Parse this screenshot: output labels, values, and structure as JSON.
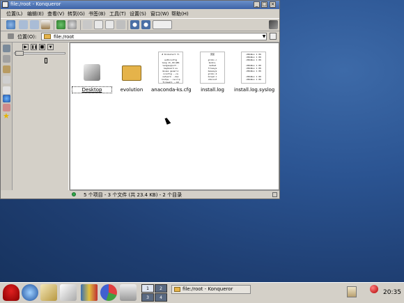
{
  "window": {
    "title": "file:/root - Konqueror",
    "menu": [
      "位置(L)",
      "编辑(E)",
      "查看(V)",
      "转到(G)",
      "书签(B)",
      "工具(T)",
      "设置(S)",
      "窗口(W)",
      "帮助(H)"
    ],
    "location_label": "位置(O):",
    "location_value": "file:/root",
    "files": [
      {
        "name": "Desktop",
        "icon": "desktop-folder-icon",
        "selected": true
      },
      {
        "name": "evolution",
        "icon": "folder-icon"
      },
      {
        "name": "anaconda-ks.cfg",
        "icon": "text-file-icon",
        "preview": "# Kickstart fi\n\nauthconfig\nlang zh_CN.GB1\nlangsupport -\nkeyboard us\nmouse generic\nxconfig --ca\nnetwork --dev\nrootpw --iscrip\nfirewall --md\nauthconfig -"
      },
      {
        "name": "install.log",
        "icon": "text-file-icon",
        "preview": "安装\n\nglibc-c\nkudzu-\nredhat\nfilesys\nbasesys\nglibc-2\nbzip2-l\nchkconf"
      },
      {
        "name": "install.log.syslog",
        "icon": "text-file-icon",
        "preview": "<86>Nov 1 09\n<86>Nov 1 09\n<86>Nov 1 09\n\n<86>Nov 1 09\n<86>Nov 1 09\n<86>Nov 1 09\n\n<86>Nov 1 09\n<86>Nov 1 09"
      }
    ],
    "status": "5 个项目 - 3 个文件 (共 23.4 KB) - 2 个目录"
  },
  "panel": {
    "pager": [
      "1",
      "2",
      "3",
      "4"
    ],
    "task_title": "file:/root - Konqueror",
    "clock": "20:35"
  },
  "colors": {
    "titlebar": "#3d63a6",
    "desktop": "#2b5492",
    "folder": "#e5b34a",
    "status_led": "#2ea84a"
  }
}
